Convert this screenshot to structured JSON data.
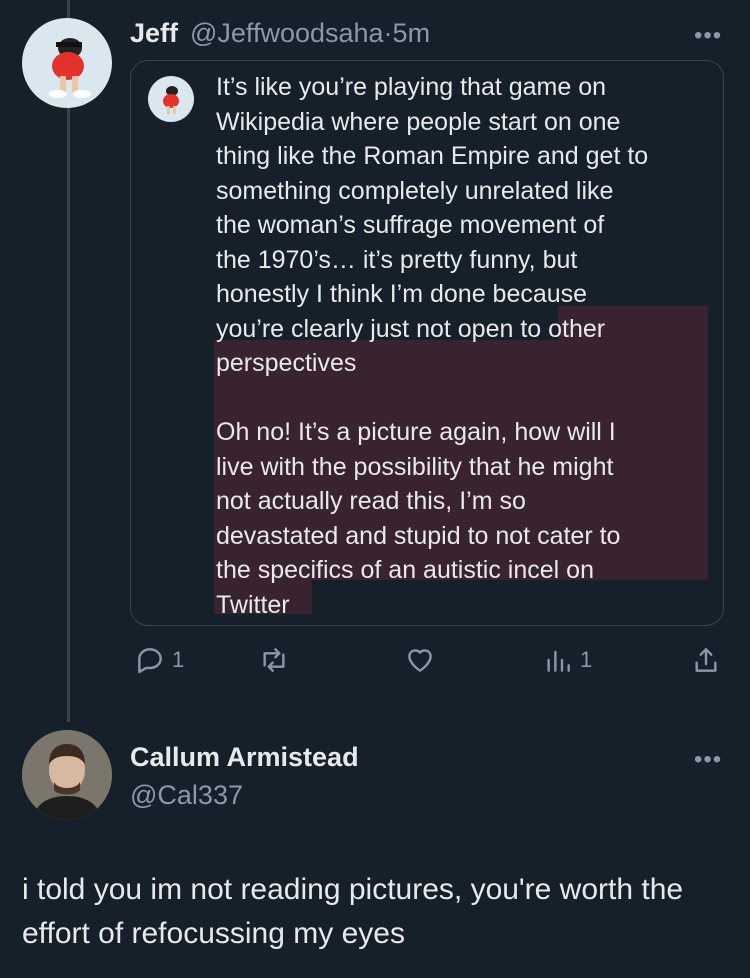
{
  "tweet": {
    "author_name": "Jeff",
    "author_handle": "@Jeffwoodsaha",
    "separator": "·",
    "time": "5m",
    "more": "•••",
    "quote": {
      "text": "It’s like you’re playing that game on\nWikipedia where people start on one\nthing like the Roman Empire and get to\nsomething completely unrelated like\nthe woman’s suffrage movement of\nthe 1970’s… it’s pretty funny, but\nhonestly I think I’m done because\nyou’re clearly just not open to other\nperspectives\n\nOh no! It’s a picture again, how will I\nlive with the possibility that he might\nnot actually read this, I’m so\ndevastated and stupid to not cater to\nthe specifics of an autistic incel on\nTwitter"
    },
    "actions": {
      "reply_count": "1",
      "views_count": "1"
    }
  },
  "reply": {
    "author_name": "Callum Armistead",
    "author_handle": "@Cal337",
    "more": "•••",
    "text": "i told you im not reading pictures, you're worth the effort of refocussing my eyes"
  },
  "icons": {
    "reply": "reply-icon",
    "retweet": "retweet-icon",
    "like": "heart-icon",
    "views": "views-icon",
    "share": "share-icon"
  },
  "colors": {
    "background": "#15202b",
    "text": "#e7e9ea",
    "muted": "#8b98a5",
    "highlight": "#3a2330",
    "border": "#38444d"
  }
}
